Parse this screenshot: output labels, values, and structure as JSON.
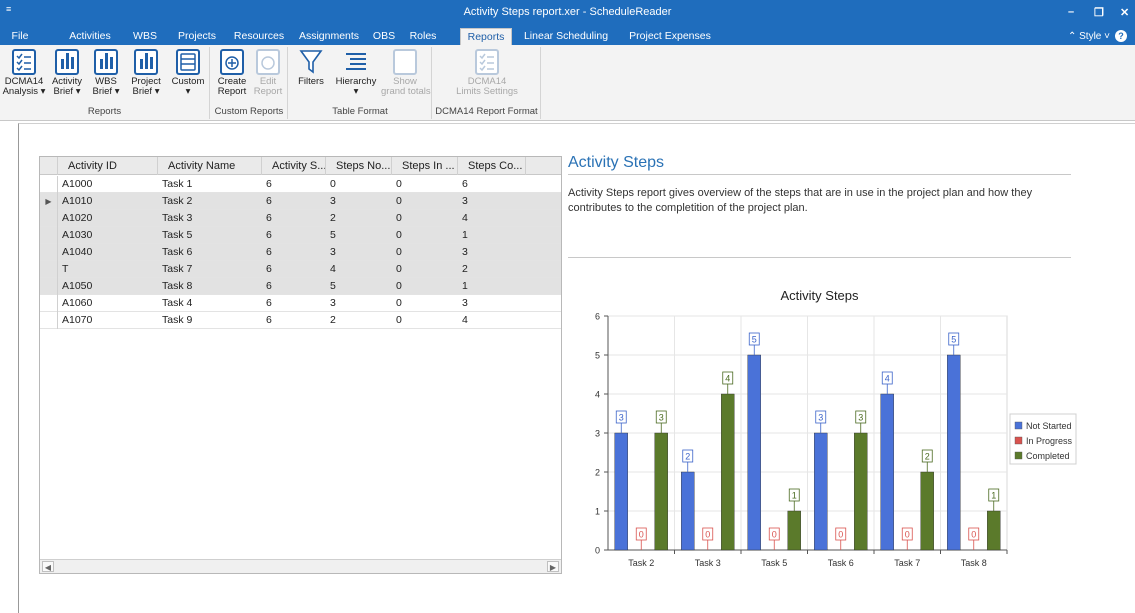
{
  "titlebar": {
    "qa": "≡",
    "title": "Activity Steps report.xer - ScheduleReader",
    "min": "–",
    "max": "❐",
    "close": "✕"
  },
  "tabs": [
    "File",
    "Activities",
    "WBS",
    "Projects",
    "Resources",
    "Assignments",
    "OBS",
    "Roles",
    "Reports",
    "Linear Scheduling",
    "Project Expenses"
  ],
  "style_label": "⌃ Style ˅",
  "help_label": "?",
  "ribbon": {
    "groups": [
      "Reports",
      "Custom Reports",
      "Table Format",
      "DCMA14 Report Format"
    ],
    "buttons": {
      "dcma14": "DCMA14\nAnalysis ▾",
      "activity_brief": "Activity\nBrief ▾",
      "wbs_brief": "WBS\nBrief ▾",
      "project_brief": "Project\nBrief ▾",
      "custom": "Custom\n▾",
      "create_report": "Create\nReport",
      "edit_report": "Edit\nReport",
      "filters": "Filters",
      "hierarchy": "Hierarchy\n▾",
      "show_grand_totals": "Show\ngrand totals",
      "dcma14_limits": "DCMA14\nLimits Settings"
    }
  },
  "grid": {
    "headers": [
      "Activity ID",
      "Activity Name",
      "Activity S...",
      "Steps No...",
      "Steps In ...",
      "Steps Co..."
    ],
    "rows": [
      [
        "A1000",
        "Task 1",
        "6",
        "0",
        "0",
        "6"
      ],
      [
        "A1010",
        "Task 2",
        "6",
        "3",
        "0",
        "3"
      ],
      [
        "A1020",
        "Task 3",
        "6",
        "2",
        "0",
        "4"
      ],
      [
        "A1030",
        "Task 5",
        "6",
        "5",
        "0",
        "1"
      ],
      [
        "A1040",
        "Task 6",
        "6",
        "3",
        "0",
        "3"
      ],
      [
        "T",
        "Task 7",
        "6",
        "4",
        "0",
        "2"
      ],
      [
        "A1050",
        "Task 8",
        "6",
        "5",
        "0",
        "1"
      ],
      [
        "A1060",
        "Task 4",
        "6",
        "3",
        "0",
        "3"
      ],
      [
        "A1070",
        "Task 9",
        "6",
        "2",
        "0",
        "4"
      ]
    ],
    "selected_rows": [
      1,
      2,
      3,
      4,
      5,
      6
    ],
    "current_row": 1,
    "current_marker": "▶"
  },
  "report": {
    "title": "Activity Steps",
    "description": "Activity Steps report gives overview of the steps that are in use in the project plan and how they contributes to the completition of the project plan."
  },
  "chart_data": {
    "type": "bar",
    "title": "Activity Steps",
    "categories": [
      "Task 2",
      "Task 3",
      "Task 5",
      "Task 6",
      "Task 7",
      "Task 8"
    ],
    "series": [
      {
        "name": "Not Started",
        "values": [
          3,
          2,
          5,
          3,
          4,
          5
        ],
        "color": "#4a72d8",
        "label_color": "#3b63c9"
      },
      {
        "name": "In Progress",
        "values": [
          0,
          0,
          0,
          0,
          0,
          0
        ],
        "color": "#d9534f",
        "label_color": "#d9534f"
      },
      {
        "name": "Completed",
        "values": [
          3,
          4,
          1,
          3,
          2,
          1
        ],
        "color": "#5b7a2b",
        "label_color": "#4a6a20"
      }
    ],
    "ylim": [
      0,
      6
    ],
    "yticks": [
      0,
      1,
      2,
      3,
      4,
      5,
      6
    ],
    "grid": true,
    "legend": "right",
    "xlabel": "",
    "ylabel": ""
  }
}
